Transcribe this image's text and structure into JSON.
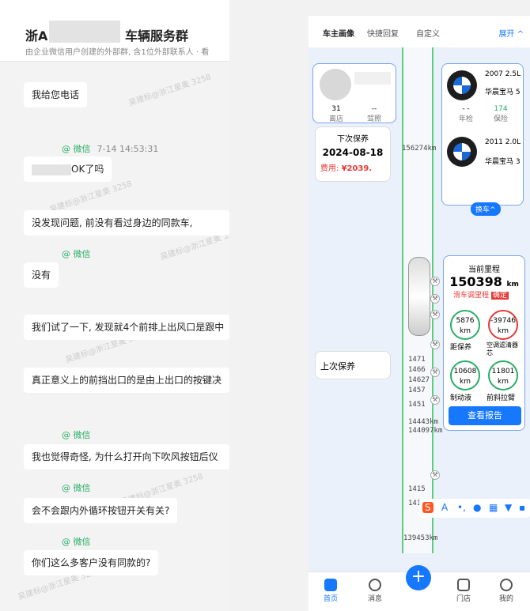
{
  "chat": {
    "title_prefix": "浙A",
    "title_suffix": "车辆服务群",
    "subtitle": "由企业微信用户创建的外部群, 含1位外部联系人 · 看",
    "watermark": "吴建标@浙江星奥 3258",
    "messages": [
      {
        "type": "bubble",
        "text": "我给您电话"
      },
      {
        "type": "sender",
        "name": "@ 微信",
        "time": "7-14 14:53:31"
      },
      {
        "type": "bubble",
        "text": "OK了吗"
      },
      {
        "type": "bubble",
        "text": "没发现问题,          前没有看过身边的同款车,"
      },
      {
        "type": "sender",
        "name": "@ 微信",
        "time": ""
      },
      {
        "type": "bubble",
        "text": "没有"
      },
      {
        "type": "bubble",
        "text": "我们试了一下, 发现就4个前排上出风口是跟中"
      },
      {
        "type": "bubble",
        "text": "真正意义上的前挡出口的是由上出口的按键决"
      },
      {
        "type": "sender",
        "name": "@ 微信",
        "time": ""
      },
      {
        "type": "bubble",
        "text": "我也觉得奇怪, 为什么打开向下吹风按钮后仪"
      },
      {
        "type": "sender",
        "name": "@ 微信",
        "time": ""
      },
      {
        "type": "bubble",
        "text": "会不会跟内外循环按钮开关有关?"
      },
      {
        "type": "sender",
        "name": "@ 微信",
        "time": ""
      },
      {
        "type": "bubble",
        "text": "你们这么多客户没有同款的?"
      }
    ]
  },
  "panel": {
    "tabs": [
      "车主画像",
      "快捷回复",
      "自定义"
    ],
    "expand": "展开 ^",
    "owner": {
      "visits": "31",
      "visits_label": "离店",
      "license": "--",
      "license_label": "驾照"
    },
    "next_service": {
      "label": "下次保养",
      "date": "2024-08-18",
      "fee_label": "费用:",
      "fee": "¥2039."
    },
    "cars": [
      {
        "year": "2007 2.5L",
        "name": "华晨宝马 5"
      },
      {
        "year": "2011 2.0L",
        "name": "华晨宝马 3"
      }
    ],
    "annual": {
      "value": "- -",
      "label": "年检"
    },
    "insurance": {
      "value": "174",
      "label": "保险"
    },
    "switch_car": "换车^",
    "mileage": {
      "title": "当前里程",
      "value": "150398",
      "unit": "km",
      "adjust": "滑车调里程",
      "confirm": "确定"
    },
    "stats": [
      {
        "value": "5876",
        "unit": "km",
        "label": "距保养",
        "color": "#2aae67"
      },
      {
        "value": "-39746",
        "unit": "km",
        "label": "空调滤清器芯",
        "color": "#e53935"
      },
      {
        "value": "10608",
        "unit": "km",
        "label": "制动液",
        "color": "#2aae67"
      },
      {
        "value": "11801",
        "unit": "km",
        "label": "前斜拉臂",
        "color": "#2aae67"
      }
    ],
    "report_button": "查看报告",
    "last_service": "上次保养",
    "km_markers": [
      "156274km",
      "1471",
      "1466",
      "14627",
      "1457",
      "1451",
      "14443km",
      "144097km",
      "1415",
      "141",
      "139453km"
    ],
    "bottom_nav": [
      "首页",
      "消息",
      "门店",
      "我的"
    ]
  },
  "colors": {
    "accent": "#1677ff",
    "green": "#2aae67",
    "red": "#e53935"
  }
}
